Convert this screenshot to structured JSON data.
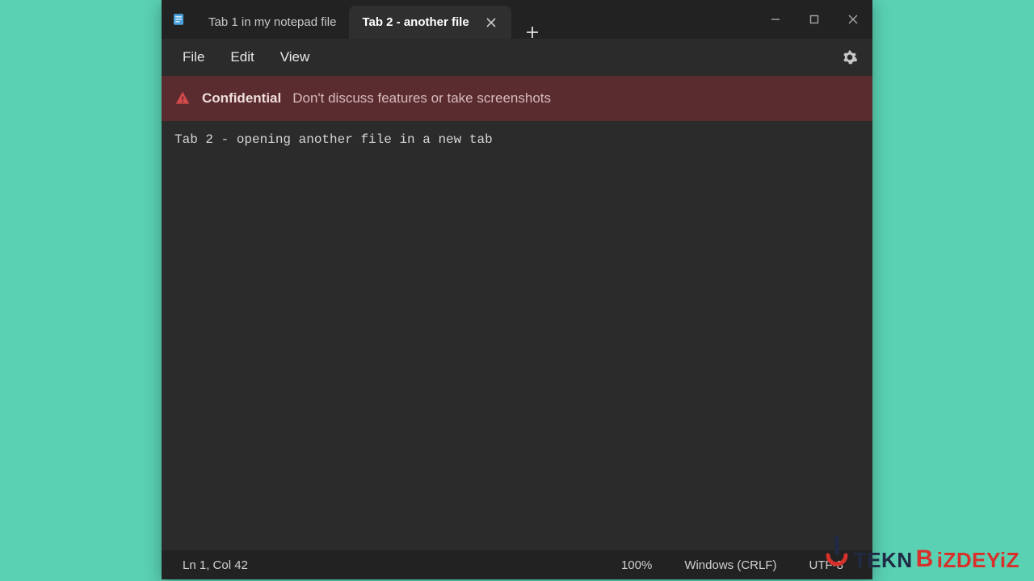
{
  "tabs": [
    {
      "label": "Tab 1 in my notepad file",
      "active": false
    },
    {
      "label": "Tab 2 - another file",
      "active": true
    }
  ],
  "menu": {
    "file": "File",
    "edit": "Edit",
    "view": "View"
  },
  "banner": {
    "title": "Confidential",
    "message": "Don't discuss features or take screenshots"
  },
  "editor": {
    "content": "Tab 2 - opening another file in a new tab"
  },
  "statusbar": {
    "position": "Ln 1, Col 42",
    "zoom": "100%",
    "line_ending": "Windows (CRLF)",
    "encoding": "UTF-8"
  },
  "watermark": {
    "part1": "TEKN",
    "part2": "B",
    "part3": "iZDEYiZ"
  }
}
